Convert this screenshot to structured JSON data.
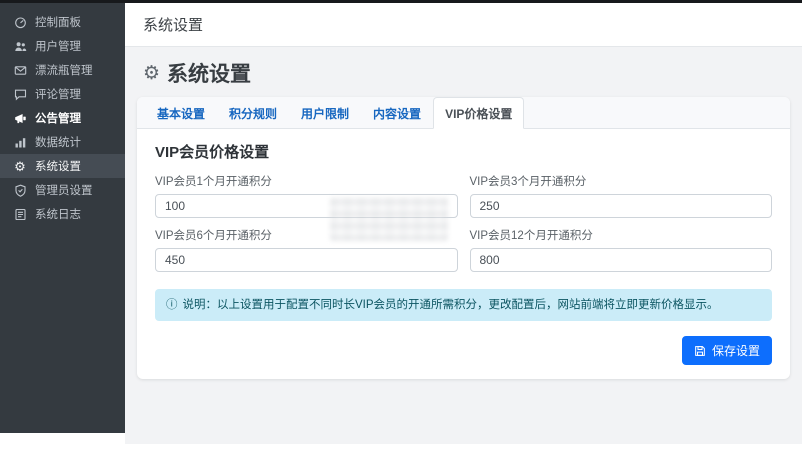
{
  "header": {
    "title": "系统设置"
  },
  "sidebar": {
    "items": [
      {
        "label": "控制面板",
        "icon": "dashboard-icon",
        "active": false,
        "highlight": false
      },
      {
        "label": "用户管理",
        "icon": "users-icon",
        "active": false,
        "highlight": false
      },
      {
        "label": "漂流瓶管理",
        "icon": "envelope-icon",
        "active": false,
        "highlight": false
      },
      {
        "label": "评论管理",
        "icon": "comment-icon",
        "active": false,
        "highlight": false
      },
      {
        "label": "公告管理",
        "icon": "megaphone-icon",
        "active": false,
        "highlight": true
      },
      {
        "label": "数据统计",
        "icon": "chart-icon",
        "active": false,
        "highlight": false
      },
      {
        "label": "系统设置",
        "icon": "gear-icon",
        "active": true,
        "highlight": false
      },
      {
        "label": "管理员设置",
        "icon": "shield-icon",
        "active": false,
        "highlight": false
      },
      {
        "label": "系统日志",
        "icon": "log-icon",
        "active": false,
        "highlight": false
      }
    ]
  },
  "page": {
    "title": "系统设置",
    "title_icon": "gear-icon"
  },
  "tabs": [
    {
      "label": "基本设置",
      "active": false
    },
    {
      "label": "积分规则",
      "active": false
    },
    {
      "label": "用户限制",
      "active": false
    },
    {
      "label": "内容设置",
      "active": false
    },
    {
      "label": "VIP价格设置",
      "active": true
    }
  ],
  "form": {
    "section_title": "VIP会员价格设置",
    "fields": [
      {
        "label": "VIP会员1个月开通积分",
        "value": "100"
      },
      {
        "label": "VIP会员3个月开通积分",
        "value": "250"
      },
      {
        "label": "VIP会员6个月开通积分",
        "value": "450"
      },
      {
        "label": "VIP会员12个月开通积分",
        "value": "800"
      }
    ],
    "note_icon": "info-circle-icon",
    "note": "说明：以上设置用于配置不同时长VIP会员的开通所需积分，更改配置后，网站前端将立即更新价格显示。",
    "save_label": "保存设置",
    "save_icon": "save-icon"
  },
  "colors": {
    "accent": "#0d6efd",
    "sidebar_bg": "#343a40",
    "sidebar_active_bg": "#454c54",
    "tab_link": "#1767c0",
    "alert_bg": "#cbecf8",
    "alert_text": "#0b5461",
    "content_bg": "#f2f3f5"
  }
}
